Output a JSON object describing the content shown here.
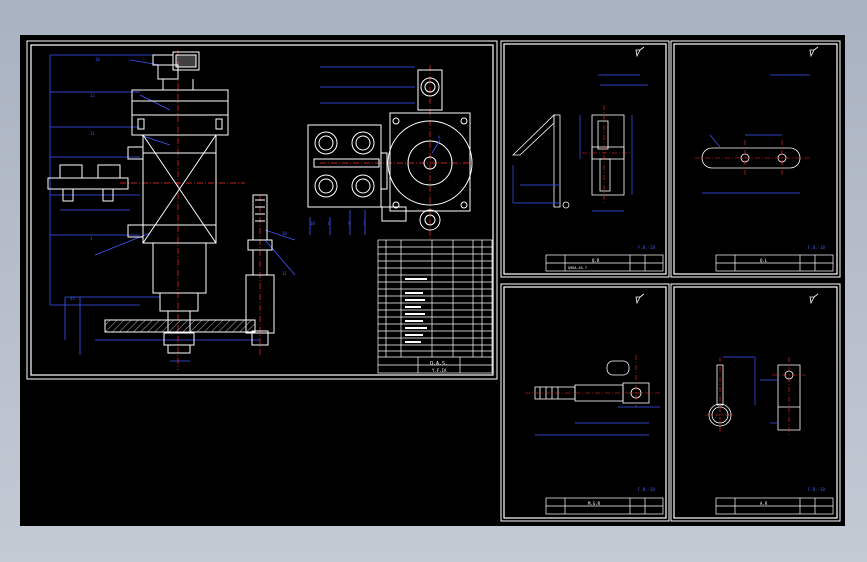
{
  "colors": {
    "background": "#000000",
    "frame": "#ffffff",
    "dimension": "#3f56ff",
    "centerline": "#ff2a2a",
    "geometry": "#ffffff",
    "viewport": "#b3bbc9"
  },
  "sheets": [
    {
      "id": "assembly",
      "kind": "assembly-drawing",
      "title_block": {
        "name": "Q.A.S.",
        "drawing_no": "Y.F.IA"
      }
    },
    {
      "id": "part-1",
      "kind": "part-drawing",
      "title_block": {
        "name": "Q.R",
        "material": "Q98A.4S.7"
      },
      "sheet_mark": "F.B.-1B"
    },
    {
      "id": "part-2",
      "kind": "part-drawing",
      "title_block": {
        "name": "Q.L"
      },
      "sheet_mark": "F.B.-1B"
    },
    {
      "id": "part-3",
      "kind": "part-drawing",
      "title_block": {
        "name": "M.G.R"
      },
      "sheet_mark": "F.B.-1B"
    },
    {
      "id": "part-4",
      "kind": "part-drawing",
      "title_block": {
        "name": "A.R"
      },
      "sheet_mark": "F.B.-1B"
    }
  ]
}
